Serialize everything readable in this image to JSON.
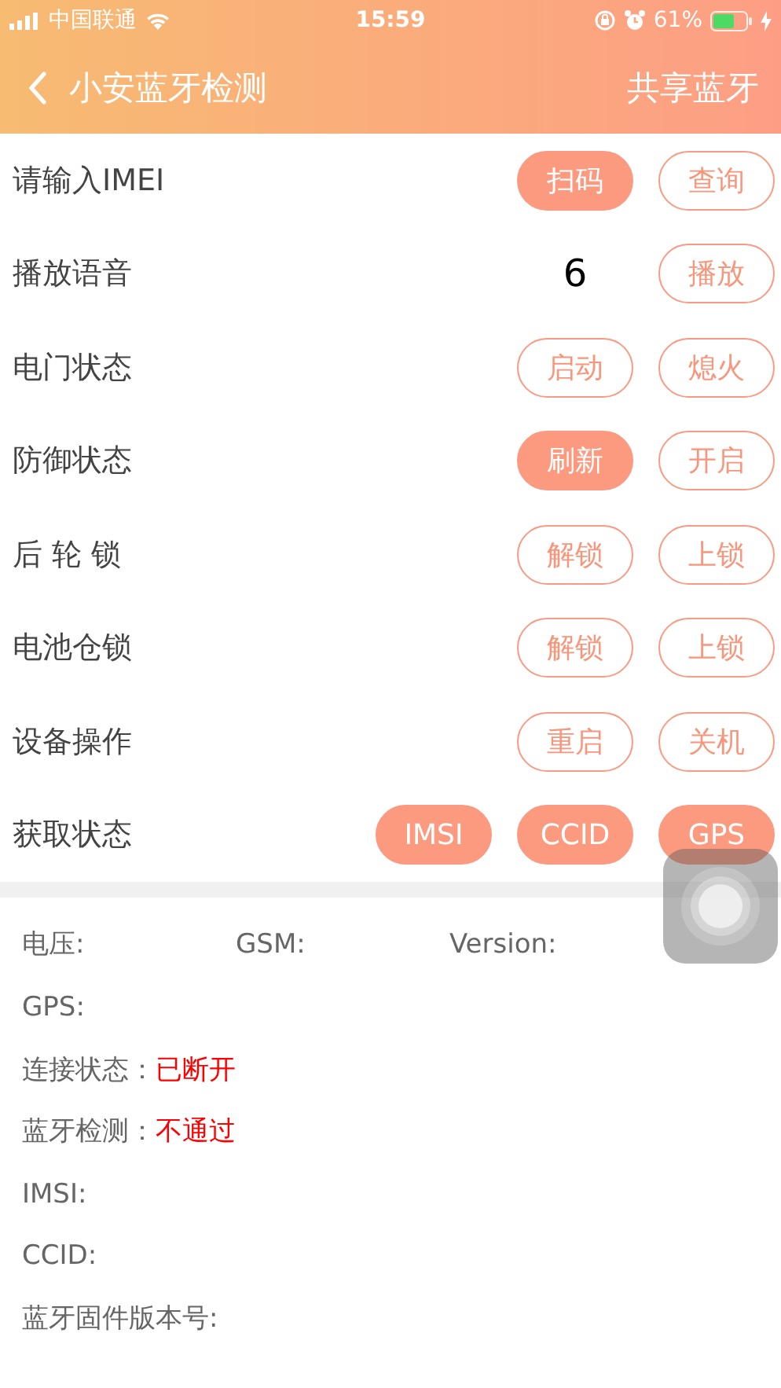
{
  "status_bar": {
    "carrier": "中国联通",
    "time": "15:59",
    "battery": "61%"
  },
  "nav": {
    "back": "小安蓝牙检测",
    "action": "共享蓝牙"
  },
  "rows": [
    {
      "placeholder": "请输入IMEI",
      "buttons": [
        {
          "label": "扫码",
          "filled": true
        },
        {
          "label": "查询",
          "filled": false
        }
      ]
    },
    {
      "label": "播放语音",
      "value": "6",
      "buttons": [
        {
          "label": "播放",
          "filled": false
        }
      ]
    },
    {
      "label": "电门状态",
      "buttons": [
        {
          "label": "启动",
          "filled": false
        },
        {
          "label": "熄火",
          "filled": false
        }
      ]
    },
    {
      "label": "防御状态",
      "buttons": [
        {
          "label": "刷新",
          "filled": true
        },
        {
          "label": "开启",
          "filled": false
        }
      ]
    },
    {
      "label": "后 轮 锁",
      "buttons": [
        {
          "label": "解锁",
          "filled": false
        },
        {
          "label": "上锁",
          "filled": false
        }
      ]
    },
    {
      "label": "电池仓锁",
      "buttons": [
        {
          "label": "解锁",
          "filled": false
        },
        {
          "label": "上锁",
          "filled": false
        }
      ]
    },
    {
      "label": "设备操作",
      "buttons": [
        {
          "label": "重启",
          "filled": false
        },
        {
          "label": "关机",
          "filled": false
        }
      ]
    },
    {
      "label": "获取状态",
      "buttons": [
        {
          "label": "IMSI",
          "filled": true
        },
        {
          "label": "CCID",
          "filled": true
        },
        {
          "label": "GPS",
          "filled": true
        }
      ]
    }
  ],
  "info": [
    [
      {
        "label": "电压:"
      },
      {
        "label": "GSM:"
      },
      {
        "label": "Version:"
      }
    ],
    [
      {
        "label": "GPS:"
      }
    ],
    [
      {
        "label": "连接状态：",
        "value": "已断开"
      }
    ],
    [
      {
        "label": "蓝牙检测：",
        "value": "不通过"
      }
    ],
    [
      {
        "label": "IMSI:"
      }
    ],
    [
      {
        "label": "CCID:"
      }
    ],
    [
      {
        "label": "蓝牙固件版本号:"
      }
    ]
  ]
}
